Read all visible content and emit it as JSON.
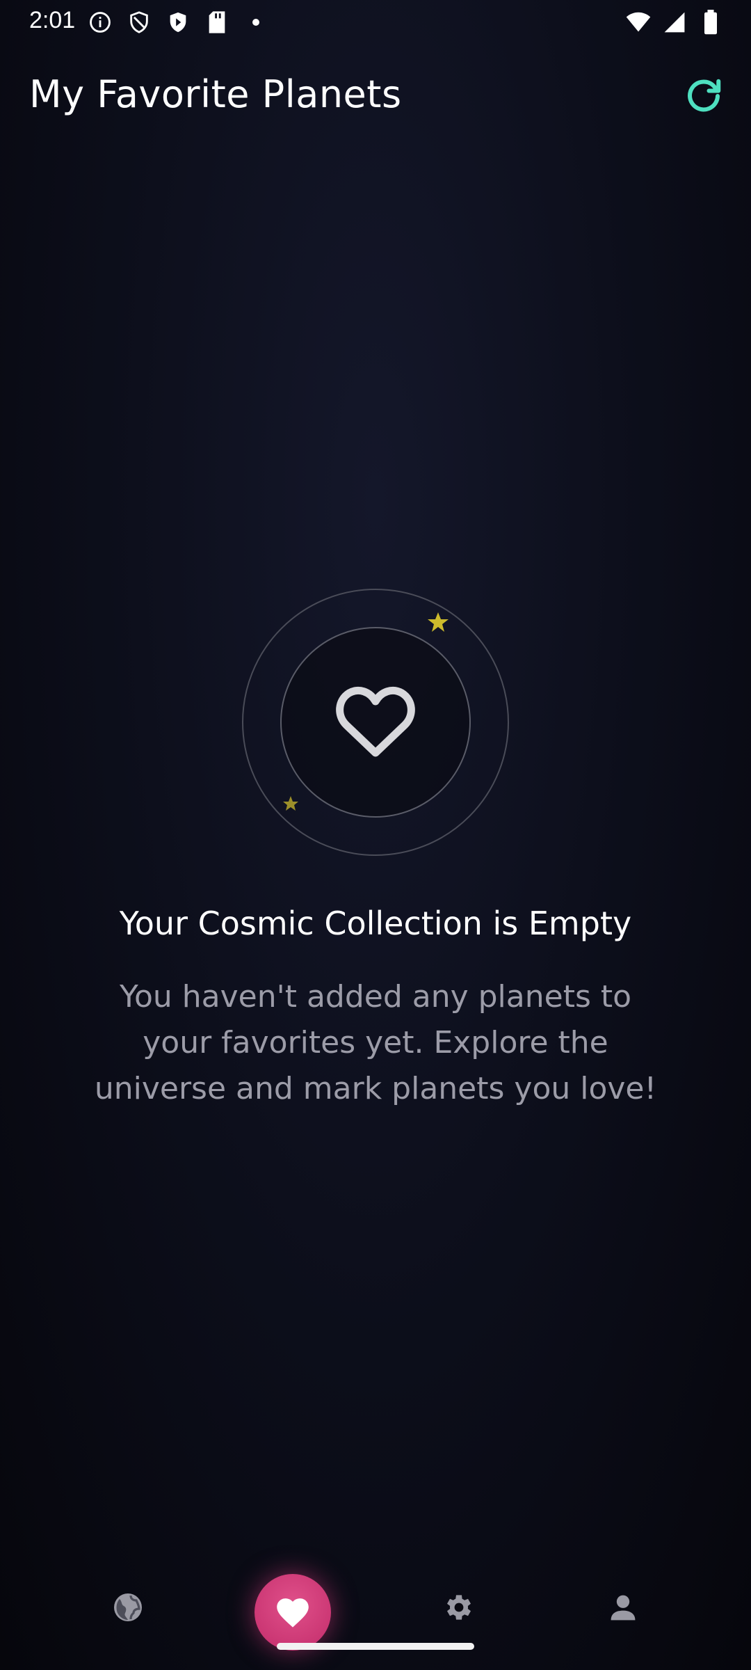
{
  "status_bar": {
    "time": "2:01",
    "left_icons": [
      "info-icon",
      "shield-icon",
      "play-shield-icon",
      "sd-card-icon",
      "dot-icon"
    ],
    "right_icons": [
      "wifi-icon",
      "signal-icon",
      "battery-icon"
    ]
  },
  "header": {
    "title": "My Favorite Planets",
    "refresh_icon": "refresh-icon",
    "accent_color": "#4ee0c0"
  },
  "empty_state": {
    "icon": "heart-icon",
    "decor_icons": [
      "star-icon",
      "star-icon"
    ],
    "title": "Your Cosmic Collection is Empty",
    "description": "You haven't added any planets to your favorites yet. Explore the universe and mark planets you love!"
  },
  "bottom_nav": {
    "items": [
      {
        "icon": "globe-icon",
        "active": false
      },
      {
        "icon": "heart-icon",
        "active": true
      },
      {
        "icon": "gear-icon",
        "active": false
      },
      {
        "icon": "person-icon",
        "active": false
      }
    ],
    "active_color": "#d63a7a"
  }
}
